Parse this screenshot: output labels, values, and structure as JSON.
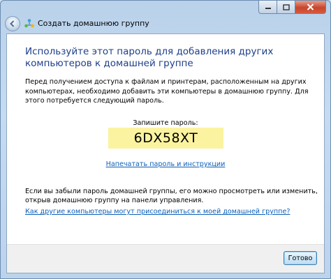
{
  "window": {
    "title": "Создать домашнюю группу"
  },
  "dialog": {
    "heading": "Используйте этот пароль для добавления других компьютеров к домашней группе",
    "description": "Перед получением доступа к файлам и принтерам, расположенным на других компьютерах, необходимо добавить эти компьютеры в домашнюю группу. Для этого потребуется следующий пароль.",
    "password_label": "Запишите пароль:",
    "password": "6DX58XT",
    "print_link": "Напечатать пароль и инструкции",
    "forgot_text": "Если вы забыли пароль домашней группы, его можно просмотреть или изменить, открыв домашнюю группу на панели управления.",
    "howto_link": "Как другие компьютеры могут присоединиться к моей домашней группе?"
  },
  "footer": {
    "done_label": "Готово"
  },
  "colors": {
    "heading": "#1e3f8a",
    "link": "#0b5fb8",
    "password_bg": "#fbf3a0"
  },
  "icons": {
    "back": "back-arrow-icon",
    "title": "homegroup-icon",
    "minimize": "minimize-icon",
    "maximize": "maximize-icon",
    "close": "close-icon"
  }
}
